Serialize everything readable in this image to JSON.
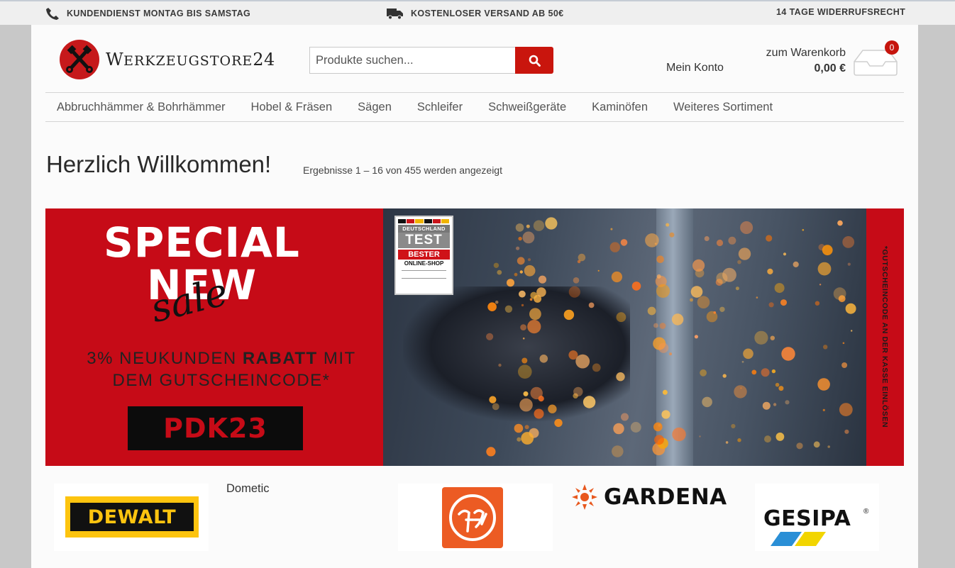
{
  "topbar": {
    "service": "KUNDENDIENST MONTAG BIS SAMSTAG",
    "shipping": "KOSTENLOSER VERSAND AB 50€",
    "returns": "14 TAGE WIDERRUFSRECHT"
  },
  "logo": {
    "word_a": "W",
    "word_b": "ERKZEUGSTORE",
    "word_c": "24"
  },
  "search": {
    "placeholder": "Produkte suchen..."
  },
  "account": {
    "label": "Mein Konto"
  },
  "cart": {
    "label": "zum Warenkorb",
    "total": "0,00 €",
    "count": "0"
  },
  "nav": {
    "items": [
      {
        "label": "Abbruchhämmer & Bohrhämmer"
      },
      {
        "label": "Hobel & Fräsen"
      },
      {
        "label": "Sägen"
      },
      {
        "label": "Schleifer"
      },
      {
        "label": "Schweißgeräte"
      },
      {
        "label": "Kaminöfen"
      },
      {
        "label": "Weiteres Sortiment"
      }
    ]
  },
  "main": {
    "title": "Herzlich Willkommen!",
    "results": "Ergebnisse 1 – 16 von 455 werden angezeigt"
  },
  "banner": {
    "line1": "SPECIAL",
    "line2": "NEW",
    "script": "sale",
    "promo_a": "3%  NEUKUNDEN ",
    "promo_b": "RABATT",
    "promo_c": " MIT",
    "promo_d": "DEM GUTSCHEINCODE*",
    "code": "PDK23",
    "side_note": "*GUTSCHEINCODE AN DER KASSE EINLÖSEN",
    "seal": {
      "top": "DEUTSCHLAND",
      "test": "TEST",
      "best": "BESTER",
      "sub": "ONLINE-SHOP"
    }
  },
  "brands": {
    "dewalt": "DEWALT",
    "dometic": "Dometic",
    "gardena": "GARDENA",
    "gesipa": "GESIPA",
    "gesipa_mark": "®"
  },
  "colors": {
    "brand_red": "#c60b17",
    "button_red": "#c9150d",
    "dewalt_yellow": "#fdc40f",
    "fein_orange": "#ec5b23"
  }
}
